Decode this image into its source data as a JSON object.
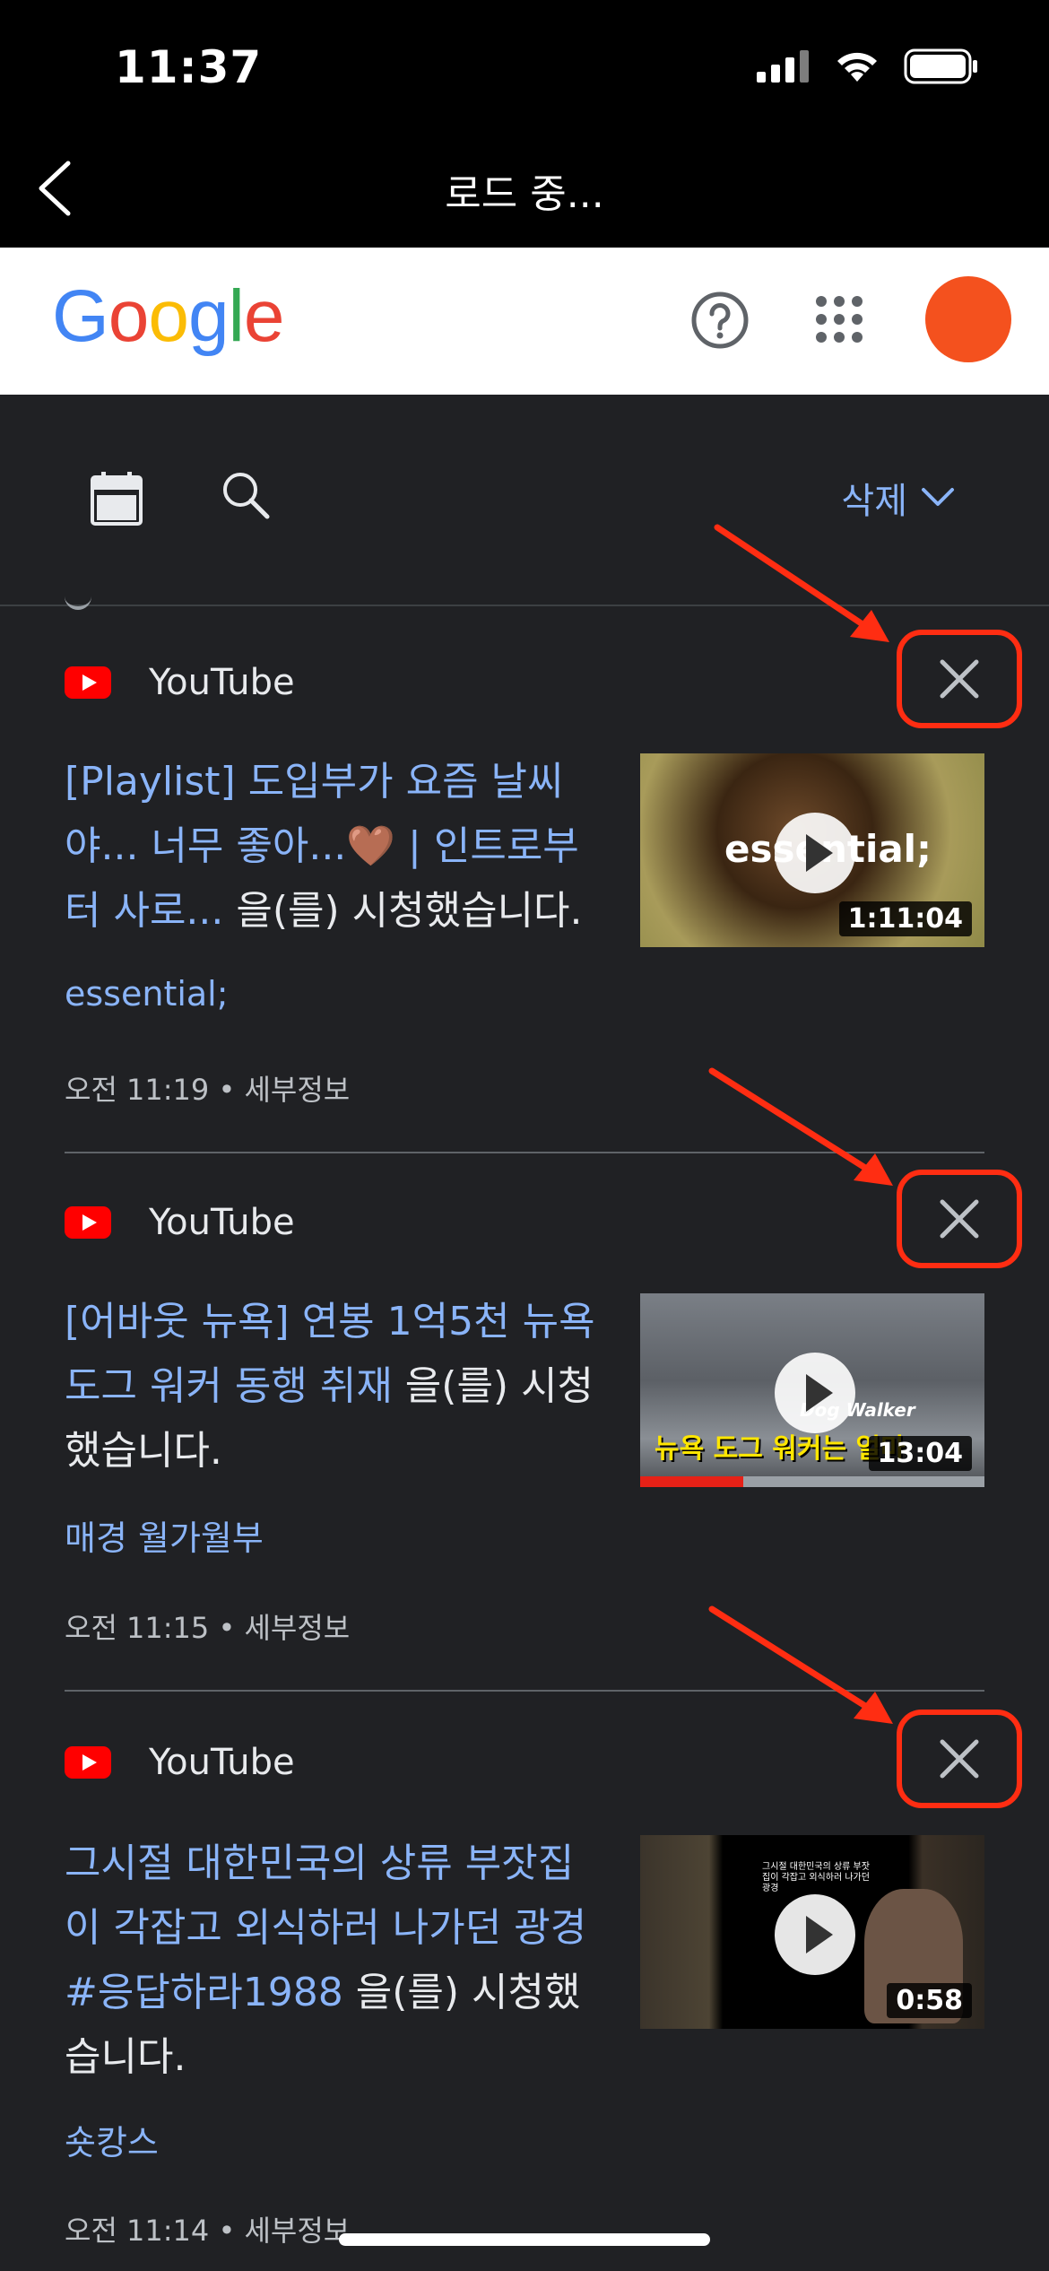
{
  "status_bar": {
    "time": "11:37"
  },
  "nav": {
    "title": "로드 중..."
  },
  "google_header": {
    "logo_letters": [
      {
        "ch": "G",
        "color": "#4285F4"
      },
      {
        "ch": "o",
        "color": "#EA4335"
      },
      {
        "ch": "o",
        "color": "#FBBC05"
      },
      {
        "ch": "g",
        "color": "#4285F4"
      },
      {
        "ch": "l",
        "color": "#34A853"
      },
      {
        "ch": "e",
        "color": "#EA4335"
      }
    ],
    "avatar_color": "#f4511e"
  },
  "toolbar": {
    "delete_label": "삭제"
  },
  "items": [
    {
      "source": "YouTube",
      "title_link": "[Playlist] 도입부가 요즘 날씨야... 너무 좋아...🤎 | 인트로부터 사로...",
      "title_suffix": " 을(를) 시청했습니다.",
      "channel": "essential;",
      "meta": "오전 11:19 • 세부정보",
      "duration": "1:11:04",
      "thumb_text": "essential;"
    },
    {
      "source": "YouTube",
      "title_link": "[어바웃 뉴욕] 연봉 1억5천 뉴욕 도그 워커 동행 취재",
      "title_suffix": " 을(를) 시청했습니다.",
      "channel": "매경 월가월부",
      "meta": "오전 11:15 • 세부정보",
      "duration": "13:04",
      "thumb_text": "뉴욕 도그 워커는 얼마",
      "thumb_subtext": "Dog Walker",
      "watch_progress": 0.3
    },
    {
      "source": "YouTube",
      "title_link": "그시절 대한민국의 상류 부잣집이 각잡고 외식하러 나가던 광경 #응답하라1988",
      "title_suffix": " 을(를) 시청했습니다.",
      "channel": "숏캉스",
      "meta": "오전 11:14 • 세부정보",
      "duration": "0:58",
      "thumb_text": "그시절 대한민국의 상류 부잣집이 각잡고 외식하러 나가던 광경"
    }
  ]
}
